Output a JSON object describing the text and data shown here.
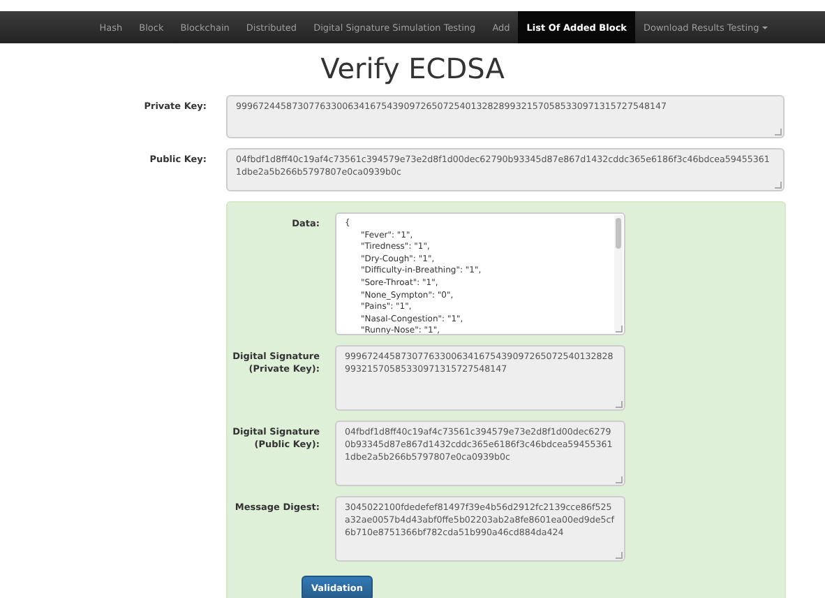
{
  "nav": {
    "items": [
      {
        "label": "Hash",
        "selected": false
      },
      {
        "label": "Block",
        "selected": false
      },
      {
        "label": "Blockchain",
        "selected": false
      },
      {
        "label": "Distributed",
        "selected": false
      },
      {
        "label": "Digital Signature Simulation Testing",
        "selected": false
      },
      {
        "label": "Add",
        "selected": false
      },
      {
        "label": "List Of Added Block",
        "selected": true
      },
      {
        "label": "Download Results Testing",
        "selected": false,
        "dropdown": true
      }
    ]
  },
  "title": "Verify ECDSA",
  "keys": [
    {
      "label": "Private Key:",
      "value": "99967244587307763300634167543909726507254013282899321570585330971315727548147"
    },
    {
      "label": "Public Key:",
      "value": "04fbdf1d8ff40c19af4c73561c394579e73e2d8f1d00dec62790b93345d87e867d1432cddc365e6186f3c46bdcea594553611dbe2a5b266b5797807e0ca0939b0c"
    }
  ],
  "panel": {
    "data": {
      "label": "Data:",
      "value": "{\n      \"Fever\": \"1\",\n      \"Tiredness\": \"1\",\n      \"Dry-Cough\": \"1\",\n      \"Difficulty-in-Breathing\": \"1\",\n      \"Sore-Throat\": \"1\",\n      \"None_Sympton\": \"0\",\n      \"Pains\": \"1\",\n      \"Nasal-Congestion\": \"1\",\n      \"Runny-Nose\": \"1\","
    },
    "fields": [
      {
        "label": "Digital Signature\n(Private Key):",
        "value": "99967244587307763300634167543909726507254013282899321570585330971315727548147"
      },
      {
        "label": "Digital Signature\n(Public Key):",
        "value": "04fbdf1d8ff40c19af4c73561c394579e73e2d8f1d00dec62790b93345d87e867d1432cddc365e6186f3c46bdcea594553611dbe2a5b266b5797807e0ca0939b0c"
      },
      {
        "label": "Message Digest:",
        "value": "3045022100fdedefef81497f39e4b56d2912fc2139cce86f525a32ae0057b4d43abf0ffe5b02203ab2a8fe8601ea00ed9de5cf6b710e8751366bf782cda51b990a46cd884da424"
      }
    ],
    "button": "Validation"
  }
}
